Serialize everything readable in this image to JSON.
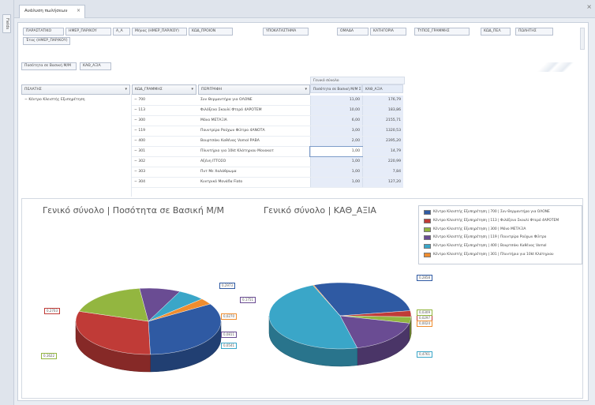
{
  "window": {
    "rail_tab_label": "Fields",
    "doc_tab_label": "Ανάλυση πωλήσεων",
    "tab_close_glyph": "×",
    "window_close_glyph": "×"
  },
  "filter_fields": [
    "ΠΑΡΑΣΤΑΤΙΚΟ",
    "ΗΜΕΡ_ΠΑΡ/ΚΟΥ",
    "Α_Α",
    "Μήνας (ΗΜΕΡ_ΠΑΡ/ΚΟΥ)",
    "ΚΩΔ_ΠΡΟΙΟΝ",
    "ΥΠΟΚΑΤΑΣΤΗΜΑ",
    "ΟΜΑΔΑ",
    "ΚΑΤΗΓΟΡΙΑ",
    "ΤΥΠΟΣ_ΓΡΑΜΜΗΣ",
    "ΚΩΔ_ΠΕΛ",
    "ΠΩΛΗΤΗΣ",
    "Έτος (ΗΜΕΡ_ΠΑΡ/ΚΟΥ)"
  ],
  "data_fields": [
    "Ποσότητα σε Βασική Μ/Μ",
    "ΚΑΘ_ΑΞΙΑ"
  ],
  "pivot": {
    "row_headers": [
      "ΠΕΛΑΤΗΣ",
      "ΚΩΔ_ΓΡΑΜΜΗΣ",
      "ΠΕΡΙΓΡΑΦΗ"
    ],
    "column_total_label": "Γενικό σύνολο",
    "value_headers": [
      "Ποσότητα σε Βασική Μ/Μ Σ",
      "ΚΑΘ_ΑΞΙΑ"
    ],
    "customer": "Κέντρο Κλειστής Εξυπηρέτηση",
    "rows": [
      {
        "code": "700",
        "description": "Συν Θερμαντήρα για ΟΛΟΝΕ",
        "qty": "11,00",
        "value": "176,79"
      },
      {
        "code": "113",
        "description": "Φιλόξενο Σκουλί Φτερό 4ΑΡΟΤΕΜ",
        "qty": "10,00",
        "value": "183,86"
      },
      {
        "code": "300",
        "description": "Μόνο ΜΕΤΑΞΙΑ",
        "qty": "6,00",
        "value": "2155,71"
      },
      {
        "code": "119",
        "description": "Πουντρίρο Ρούχων Φίλτρο 4ΑΝΟΤΑ",
        "qty": "3,00",
        "value": "1320,53"
      },
      {
        "code": "400",
        "description": "Βουρτσάκι Καθένας Vomol ΡΑΒΑ",
        "qty": "2,00",
        "value": "2395,20"
      },
      {
        "code": "301",
        "description": "Πλυντήριο για 10kt Κλάτηριου Μονοκατ",
        "qty": "1,00",
        "value": "14,79"
      },
      {
        "code": "302",
        "description": "Αξένη ΙΤΤΟΣΟ",
        "qty": "1,00",
        "value": "220,99"
      },
      {
        "code": "303",
        "description": "Πυτ Με Χαλάθρωμα",
        "qty": "1,00",
        "value": "7,84"
      },
      {
        "code": "304",
        "description": "Κυντρικό Μονάδα Fiato",
        "qty": "1,00",
        "value": "127,20"
      }
    ]
  },
  "charts_titles": [
    "Γενικό σύνολο | Ποσότητα σε Βασική Μ/Μ",
    "Γενικό σύνολο | ΚΑΘ_ΑΞΙΑ"
  ],
  "legend": [
    "Κέντρο Κλειστής Εξυπηρέτηση | 700 | Συν Θερμαντήρα για ΟΛΟΝΕ",
    "Κέντρο Κλειστής Εξυπηρέτηση | 113 | Φιλόξενο Σκουλί Φτερό 4ΑΡΟΤΕΜ",
    "Κέντρο Κλειστής Εξυπηρέτηση | 300 | Μόνο ΜΕΤΑΞΙΑ",
    "Κέντρο Κλειστής Εξυπηρέτηση | 119 | Πουντρίρο Ρούχων Φίλτρο",
    "Κέντρο Κλειστής Εξυπηρέτηση | 400 | Βουρτσάκι Καθένας Vomol",
    "Κέντρο Κλειστής Εξυπηρέτηση | 301 | Πλυντήριο για 10kt Κλάτηριου"
  ],
  "colors": {
    "series": [
      "#2f5aa3",
      "#c03b37",
      "#93b640",
      "#6a4c93",
      "#3aa6c8",
      "#ef8d2f"
    ]
  },
  "chart_data": [
    {
      "type": "pie",
      "title": "Γενικό σύνολο | Ποσότητα σε Βασική Μ/Μ",
      "categories": [
        "700",
        "113",
        "300",
        "119",
        "400",
        "301"
      ],
      "values": [
        0.2973,
        0.2703,
        0.1622,
        0.0811,
        0.0541,
        0.027
      ],
      "labels": [
        "0,2973",
        "0,2703",
        "0,1622",
        "0,0811",
        "0,0541",
        "0,0270"
      ]
    },
    {
      "type": "pie",
      "title": "Γενικό σύνολο | ΚΑΘ_ΑΞΙΑ",
      "categories": [
        "700",
        "113",
        "300",
        "119",
        "400",
        "301"
      ],
      "values": [
        0.2858,
        0.0297,
        0.0309,
        0.1751,
        0.4761,
        0.0024
      ],
      "labels": [
        "0,2858",
        "0,0297",
        "0,0309",
        "0,1751",
        "0,4761",
        "0,0024"
      ]
    }
  ]
}
